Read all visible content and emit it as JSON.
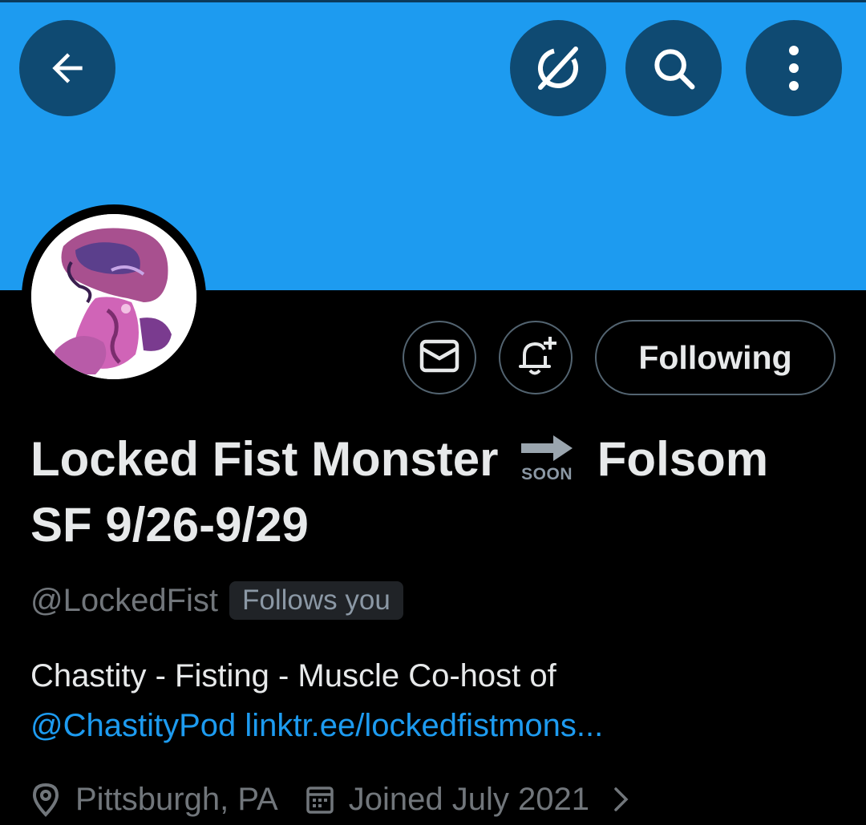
{
  "header": {
    "back_icon": "arrow-left-icon",
    "grok_icon": "grok-icon",
    "search_icon": "search-icon",
    "more_icon": "more-vertical-icon",
    "banner_color": "#1d9bf0"
  },
  "profile": {
    "display_name_part1": "Locked Fist Monster",
    "emoji_text": "SOON",
    "display_name_part2": "Folsom SF 9/26-9/29",
    "handle": "@LockedFist",
    "follows_you": "Follows you",
    "follow_button_label": "Following",
    "message_icon": "envelope-icon",
    "notify_icon": "bell-plus-icon"
  },
  "bio": {
    "text": "Chastity - Fisting - Muscle Co-host of",
    "mention": "@ChastityPod",
    "link": "linktr.ee/lockedfistmons..."
  },
  "meta": {
    "location": "Pittsburgh, PA",
    "joined": "Joined July 2021",
    "location_icon": "location-pin-icon",
    "calendar_icon": "calendar-icon",
    "chevron_icon": "chevron-right-icon"
  },
  "colors": {
    "accent": "#1d9bf0",
    "background": "#000000",
    "text_primary": "#e7e9ea",
    "text_secondary": "#71767b",
    "button_circle": "#0f4a72"
  }
}
